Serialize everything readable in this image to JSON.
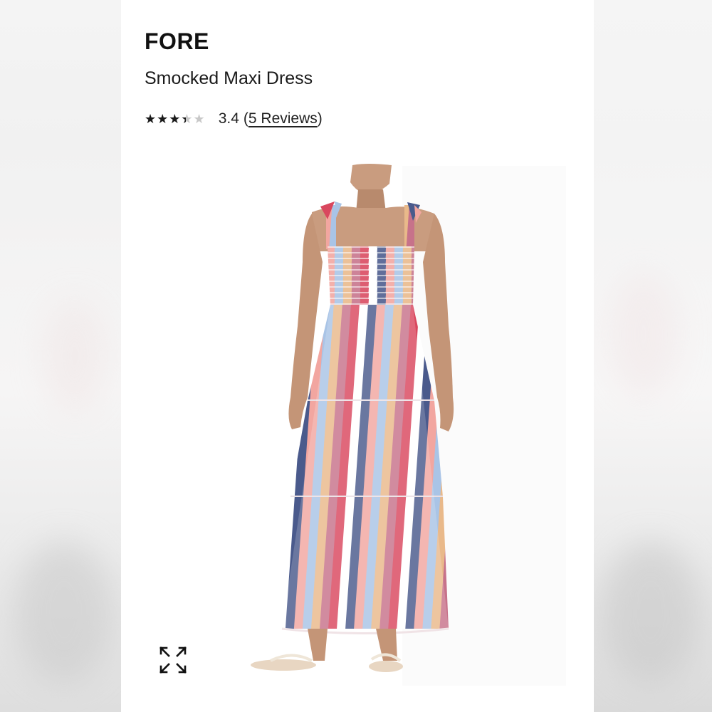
{
  "product": {
    "brand": "FORE",
    "name": "Smocked Maxi Dress",
    "rating": {
      "value": 3.4,
      "value_text": "3.4",
      "max": 5,
      "reviews_prefix": "(",
      "reviews_text": "5 Reviews",
      "reviews_suffix": ")"
    },
    "image": {
      "alt": "Smocked Maxi Dress"
    }
  },
  "icons": {
    "rating": "star-icon",
    "expand": "expand-arrows-icon"
  },
  "colors": {
    "text": "#111111",
    "star_filled": "#1a1a1a",
    "star_empty": "#c8c8c8",
    "stripes": [
      "#d9475e",
      "#f2a6a0",
      "#4a5a8c",
      "#e9b98a",
      "#a9c4e6",
      "#c7728a",
      "#ffffff"
    ]
  }
}
